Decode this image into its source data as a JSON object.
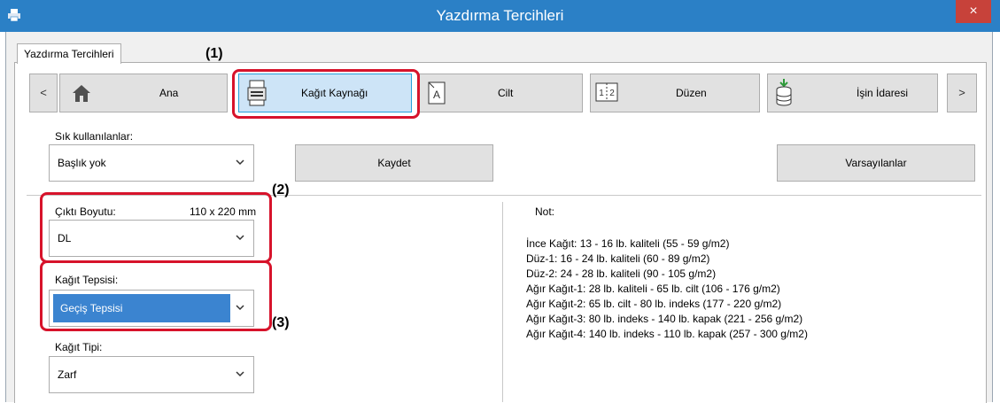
{
  "window": {
    "title": "Yazdırma Tercihleri",
    "close_glyph": "×"
  },
  "dialog_tab": "Yazdırma Tercihleri",
  "toolbar": {
    "prev_glyph": "<",
    "next_glyph": ">",
    "items": [
      {
        "label": "Ana",
        "icon": "home-icon"
      },
      {
        "label": "Kağıt Kaynağı",
        "icon": "paper-tray-icon",
        "selected": true
      },
      {
        "label": "Cilt",
        "icon": "binding-icon"
      },
      {
        "label": "Düzen",
        "icon": "layout-icon"
      },
      {
        "label": "İşin İdaresi",
        "icon": "job-handling-icon"
      }
    ]
  },
  "favorites": {
    "label": "Sık kullanılanlar:",
    "value": "Başlık yok",
    "save_label": "Kaydet",
    "defaults_label": "Varsayılanlar"
  },
  "output_size": {
    "label": "Çıktı Boyutu:",
    "dimension": "110 x 220 mm",
    "value": "DL"
  },
  "paper_tray": {
    "label": "Kağıt Tepsisi:",
    "value": "Geçiş Tepsisi"
  },
  "paper_type": {
    "label": "Kağıt Tipi:",
    "value": "Zarf"
  },
  "callouts": [
    "(1)",
    "(2)",
    "(3)"
  ],
  "note": {
    "title": "Not:",
    "lines": [
      "İnce Kağıt: 13 - 16 lb. kaliteli (55 - 59 g/m2)",
      "Düz-1: 16 - 24 lb. kaliteli (60 - 89 g/m2)",
      "Düz-2: 24 - 28 lb. kaliteli (90 - 105 g/m2)",
      "Ağır Kağıt-1: 28 lb. kaliteli - 65 lb. cilt (106 - 176 g/m2)",
      "Ağır Kağıt-2: 65 lb. cilt - 80 lb. indeks (177 - 220 g/m2)",
      "Ağır Kağıt-3: 80 lb. indeks - 140 lb. kapak (221 - 256 g/m2)",
      "Ağır Kağıt-4: 140 lb. indeks - 110 lb. kapak (257 - 300 g/m2)"
    ]
  },
  "colors": {
    "titlebar": "#2b80c6",
    "close": "#c7423a",
    "highlight": "#d7132b",
    "selection": "#3b84d0"
  }
}
